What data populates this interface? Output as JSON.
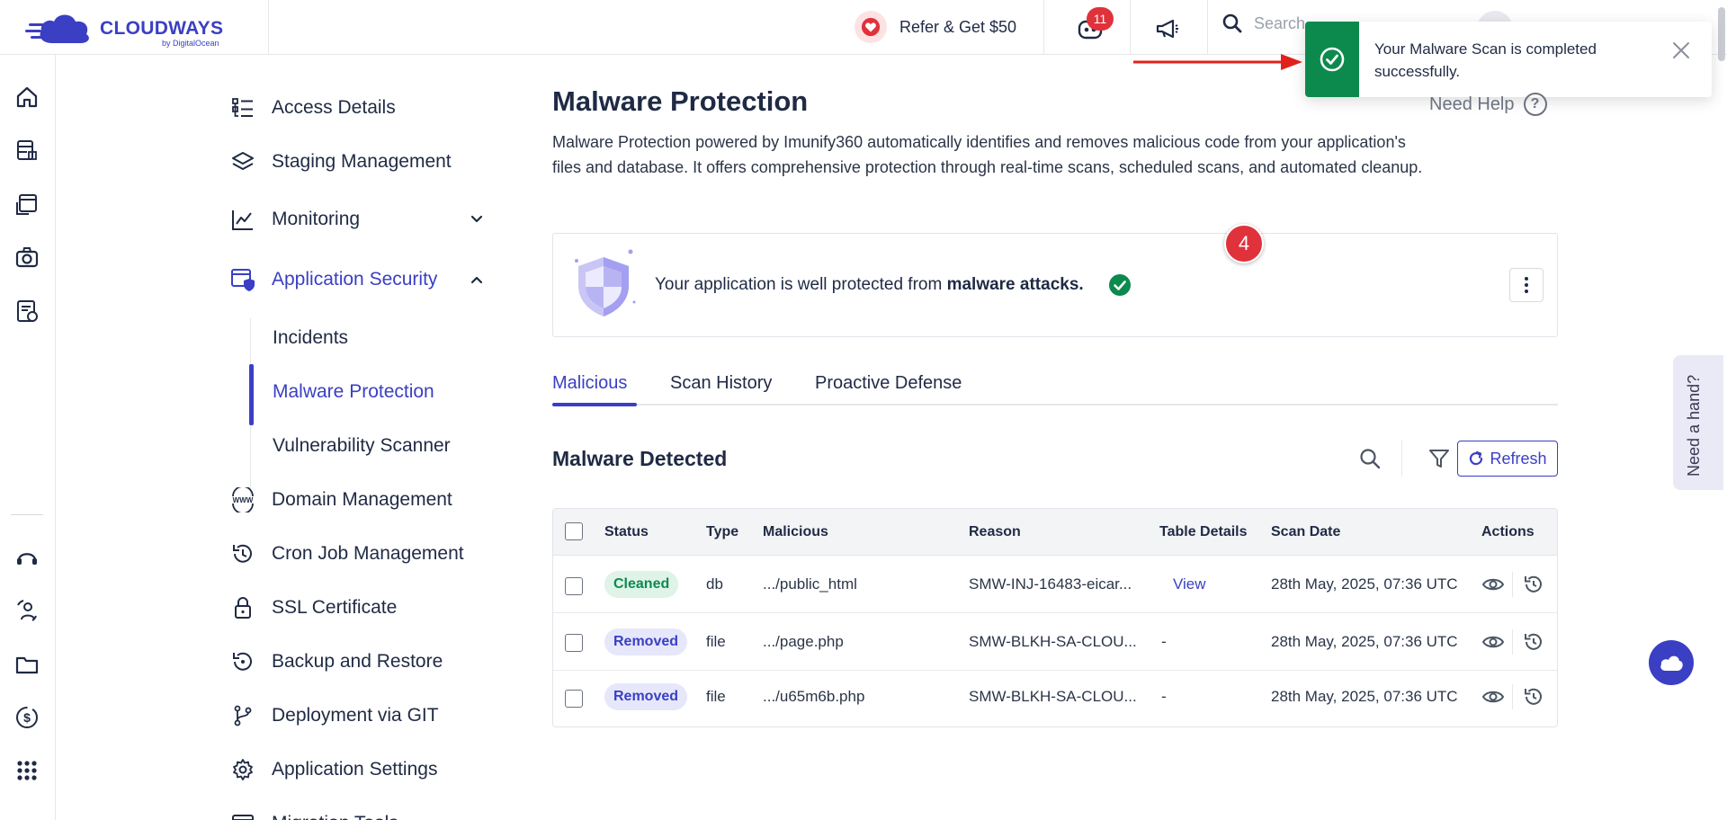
{
  "brand": {
    "name": "CLOUDWAYS",
    "sub": "by DigitalOcean"
  },
  "topbar": {
    "refer_label": "Refer & Get $50",
    "notification_count": "11",
    "search_placeholder": "Search"
  },
  "toast": {
    "message": "Your Malware Scan is completed successfully."
  },
  "subnav": {
    "items": [
      {
        "label": "Access Details"
      },
      {
        "label": "Staging Management"
      },
      {
        "label": "Monitoring"
      },
      {
        "label": "Application Security"
      },
      {
        "label": "Domain Management"
      },
      {
        "label": "Cron Job Management"
      },
      {
        "label": "SSL Certificate"
      },
      {
        "label": "Backup and Restore"
      },
      {
        "label": "Deployment via GIT"
      },
      {
        "label": "Application Settings"
      },
      {
        "label": "Migration Tools"
      }
    ],
    "security_children": [
      {
        "label": "Incidents"
      },
      {
        "label": "Malware Protection"
      },
      {
        "label": "Vulnerability Scanner"
      }
    ]
  },
  "main": {
    "title": "Malware Protection",
    "need_help": "Need Help",
    "description": "Malware Protection powered by Imunify360 automatically identifies and removes malicious code from your application's files and database. It offers comprehensive protection through real-time scans, scheduled scans, and automated cleanup.",
    "status_prefix": "Your application is well protected from ",
    "status_bold": "malware attacks.",
    "step_badge": "4",
    "tabs": [
      {
        "label": "Malicious"
      },
      {
        "label": "Scan History"
      },
      {
        "label": "Proactive Defense"
      }
    ],
    "section_title": "Malware Detected",
    "refresh_label": "Refresh"
  },
  "table": {
    "headers": [
      "Status",
      "Type",
      "Malicious",
      "Reason",
      "Table Details",
      "Scan Date",
      "Actions"
    ],
    "rows": [
      {
        "status": "Cleaned",
        "type": "db",
        "malicious": ".../public_html",
        "reason": "SMW-INJ-16483-eicar...",
        "details": "View",
        "date": "28th May, 2025, 07:36 UTC"
      },
      {
        "status": "Removed",
        "type": "file",
        "malicious": ".../page.php",
        "reason": "SMW-BLKH-SA-CLOU...",
        "details": "-",
        "date": "28th May, 2025, 07:36 UTC"
      },
      {
        "status": "Removed",
        "type": "file",
        "malicious": ".../u65m6b.php",
        "reason": "SMW-BLKH-SA-CLOU...",
        "details": "-",
        "date": "28th May, 2025, 07:36 UTC"
      }
    ]
  },
  "widgets": {
    "need_hand": "Need a hand?"
  },
  "colors": {
    "accent": "#3a3fc4",
    "success": "#0c8a4d",
    "danger": "#e0323b"
  }
}
